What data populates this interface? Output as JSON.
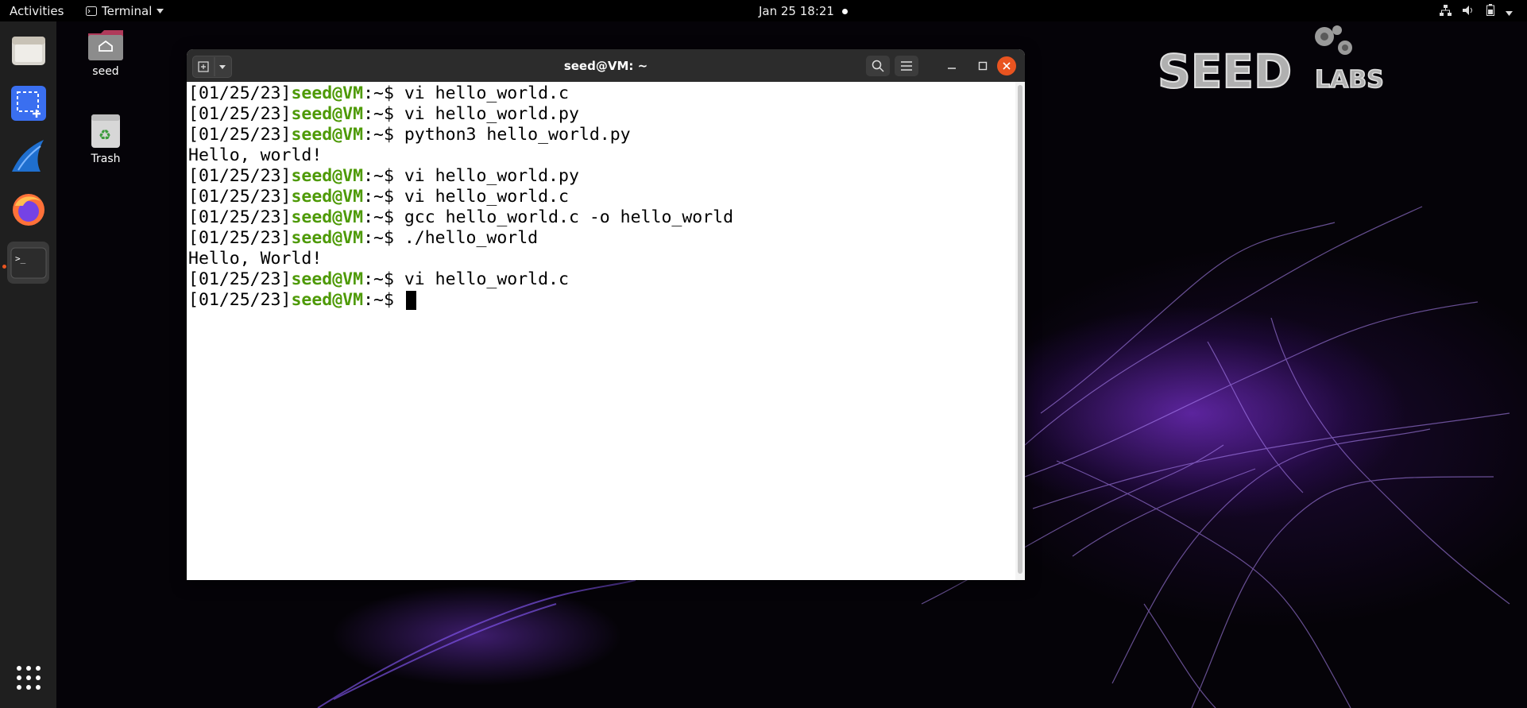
{
  "topbar": {
    "activities_label": "Activities",
    "app_menu_label": "Terminal",
    "clock": "Jan 25  18:21"
  },
  "desktop": {
    "icons": [
      {
        "label": "seed",
        "icon": "home-folder-icon"
      },
      {
        "label": "Trash",
        "icon": "trash-icon"
      }
    ]
  },
  "dock": {
    "items": [
      "files-icon",
      "screenshot-icon",
      "wireshark-icon",
      "firefox-icon",
      "terminal-icon"
    ],
    "show_apps": "app-grid-icon"
  },
  "window": {
    "title": "seed@VM: ~"
  },
  "terminal": {
    "lines": [
      {
        "type": "prompt",
        "date": "[01/25/23]",
        "user": "seed@VM",
        "path": ":~$ ",
        "cmd": "vi hello_world.c"
      },
      {
        "type": "prompt",
        "date": "[01/25/23]",
        "user": "seed@VM",
        "path": ":~$ ",
        "cmd": "vi hello_world.py"
      },
      {
        "type": "prompt",
        "date": "[01/25/23]",
        "user": "seed@VM",
        "path": ":~$ ",
        "cmd": "python3 hello_world.py"
      },
      {
        "type": "output",
        "text": "Hello, world!"
      },
      {
        "type": "prompt",
        "date": "[01/25/23]",
        "user": "seed@VM",
        "path": ":~$ ",
        "cmd": "vi hello_world.py"
      },
      {
        "type": "prompt",
        "date": "[01/25/23]",
        "user": "seed@VM",
        "path": ":~$ ",
        "cmd": "vi hello_world.c"
      },
      {
        "type": "prompt",
        "date": "[01/25/23]",
        "user": "seed@VM",
        "path": ":~$ ",
        "cmd": "gcc hello_world.c -o hello_world"
      },
      {
        "type": "prompt",
        "date": "[01/25/23]",
        "user": "seed@VM",
        "path": ":~$ ",
        "cmd": "./hello_world"
      },
      {
        "type": "output",
        "text": "Hello, World!"
      },
      {
        "type": "prompt",
        "date": "[01/25/23]",
        "user": "seed@VM",
        "path": ":~$ ",
        "cmd": "vi hello_world.c"
      },
      {
        "type": "prompt",
        "date": "[01/25/23]",
        "user": "seed@VM",
        "path": ":~$ ",
        "cmd": ""
      }
    ]
  },
  "logo": {
    "text_main": "SEED",
    "text_sub": "LABS"
  },
  "colors": {
    "prompt_user": "#4e9a06",
    "close_button": "#e95420",
    "topbar": "#000000",
    "dock": "#1f1f1f"
  }
}
